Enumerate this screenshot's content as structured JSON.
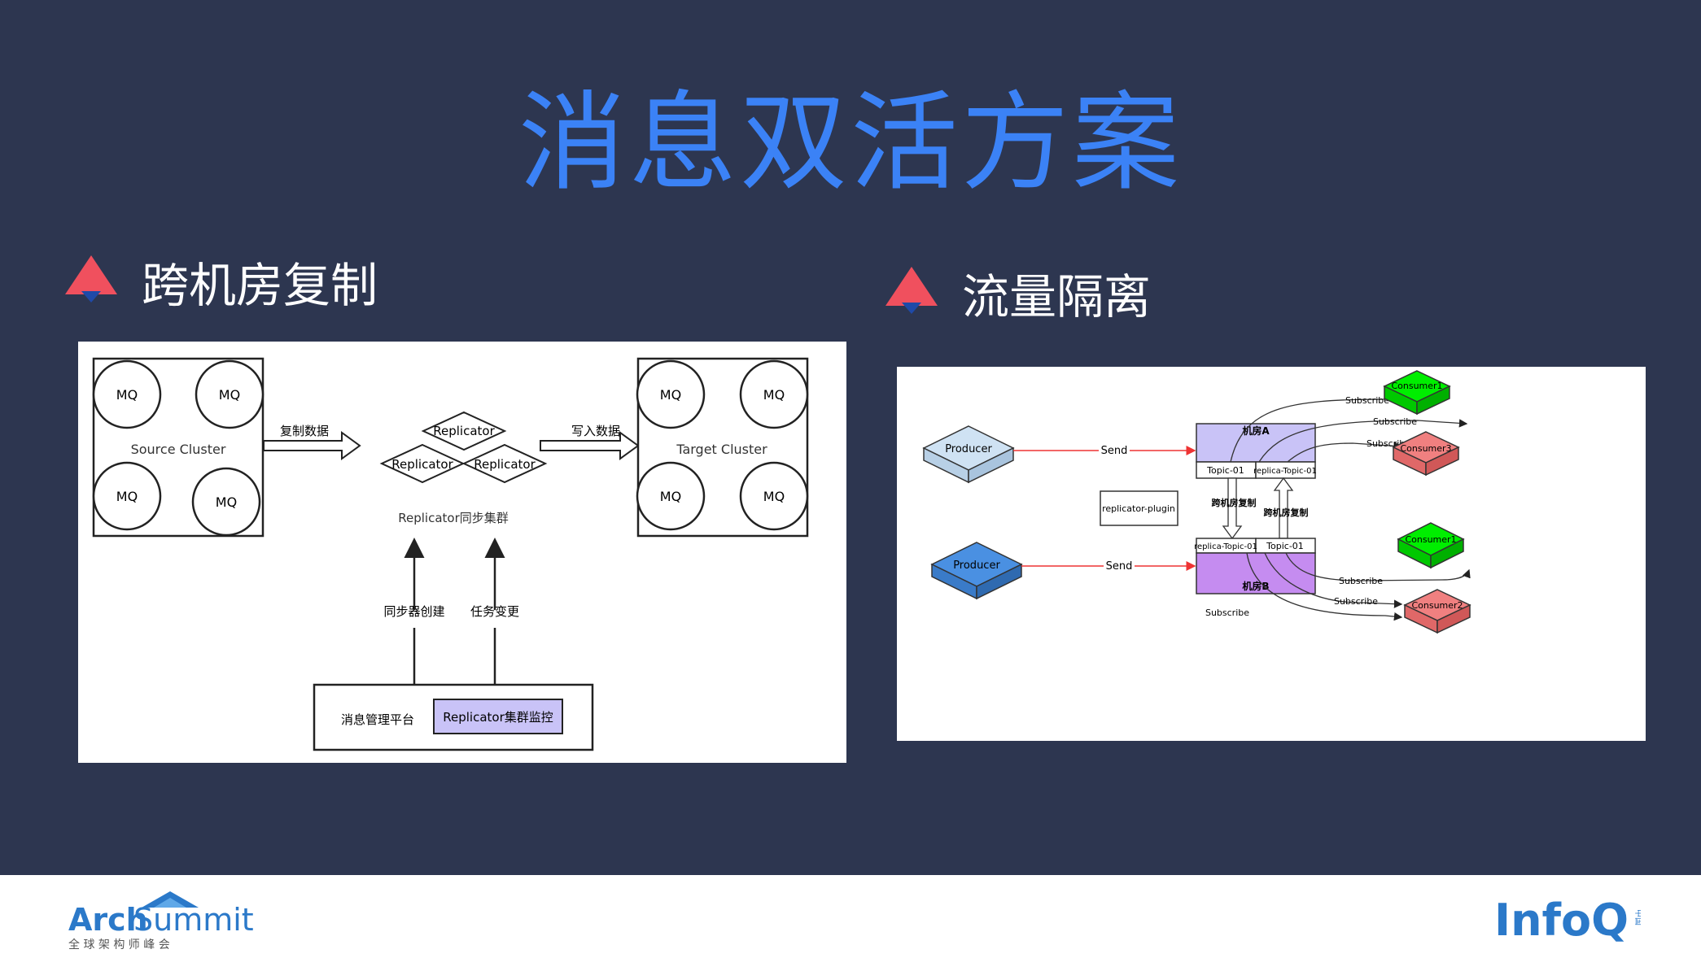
{
  "title": "消息双活方案",
  "left_section": {
    "heading": "跨机房复制",
    "diagram": {
      "source_cluster": {
        "label": "Source Cluster",
        "nodes": [
          "MQ",
          "MQ",
          "MQ",
          "MQ"
        ]
      },
      "target_cluster": {
        "label": "Target Cluster",
        "nodes": [
          "MQ",
          "MQ",
          "MQ",
          "MQ"
        ]
      },
      "replicators": [
        "Replicator",
        "Replicator",
        "Replicator"
      ],
      "replicator_group_label": "Replicator同步集群",
      "arrow_copy_label": "复制数据",
      "arrow_write_label": "写入数据",
      "arrow_create_label": "同步器创建",
      "arrow_change_label": "任务变更",
      "platform_label": "消息管理平台",
      "monitor_label": "Replicator集群监控"
    }
  },
  "right_section": {
    "heading": "流量隔离",
    "diagram": {
      "producer_a": "Producer",
      "producer_b": "Producer",
      "send_a": "Send",
      "send_b": "Send",
      "room_a": "机房A",
      "room_b": "机房B",
      "room_a_topics": [
        "Topic-01",
        "replica-Topic-01"
      ],
      "room_b_topics": [
        "replica-Topic-01",
        "Topic-01"
      ],
      "plugin": "replicator-plugin",
      "replicate_label_1": "跨机房复制",
      "replicate_label_2": "跨机房复制",
      "subscribe_labels": [
        "Subscribe",
        "Subscribe",
        "Subscribe",
        "Subscribe",
        "Subscribe",
        "Subscribe"
      ],
      "consumer_top_1": "Consumer1",
      "consumer_top_3": "Consumer3",
      "consumer_bottom_1": "Consumer1",
      "consumer_bottom_2": "Consumer2",
      "colors": {
        "producer_a": "#cfe2f3",
        "producer_b": "#4a90e2",
        "consumer_green": "#00ee00",
        "consumer_red": "#f08080",
        "room_a": "#c9c3f7",
        "room_b": "#c58cf0"
      }
    }
  },
  "footer": {
    "archsummit_arch": "Arch",
    "archsummit_summit": "Summit",
    "archsummit_sub": "全 球 架 构 师 峰 会",
    "infoq": "InfoQ",
    "infoq_small": "中国"
  }
}
